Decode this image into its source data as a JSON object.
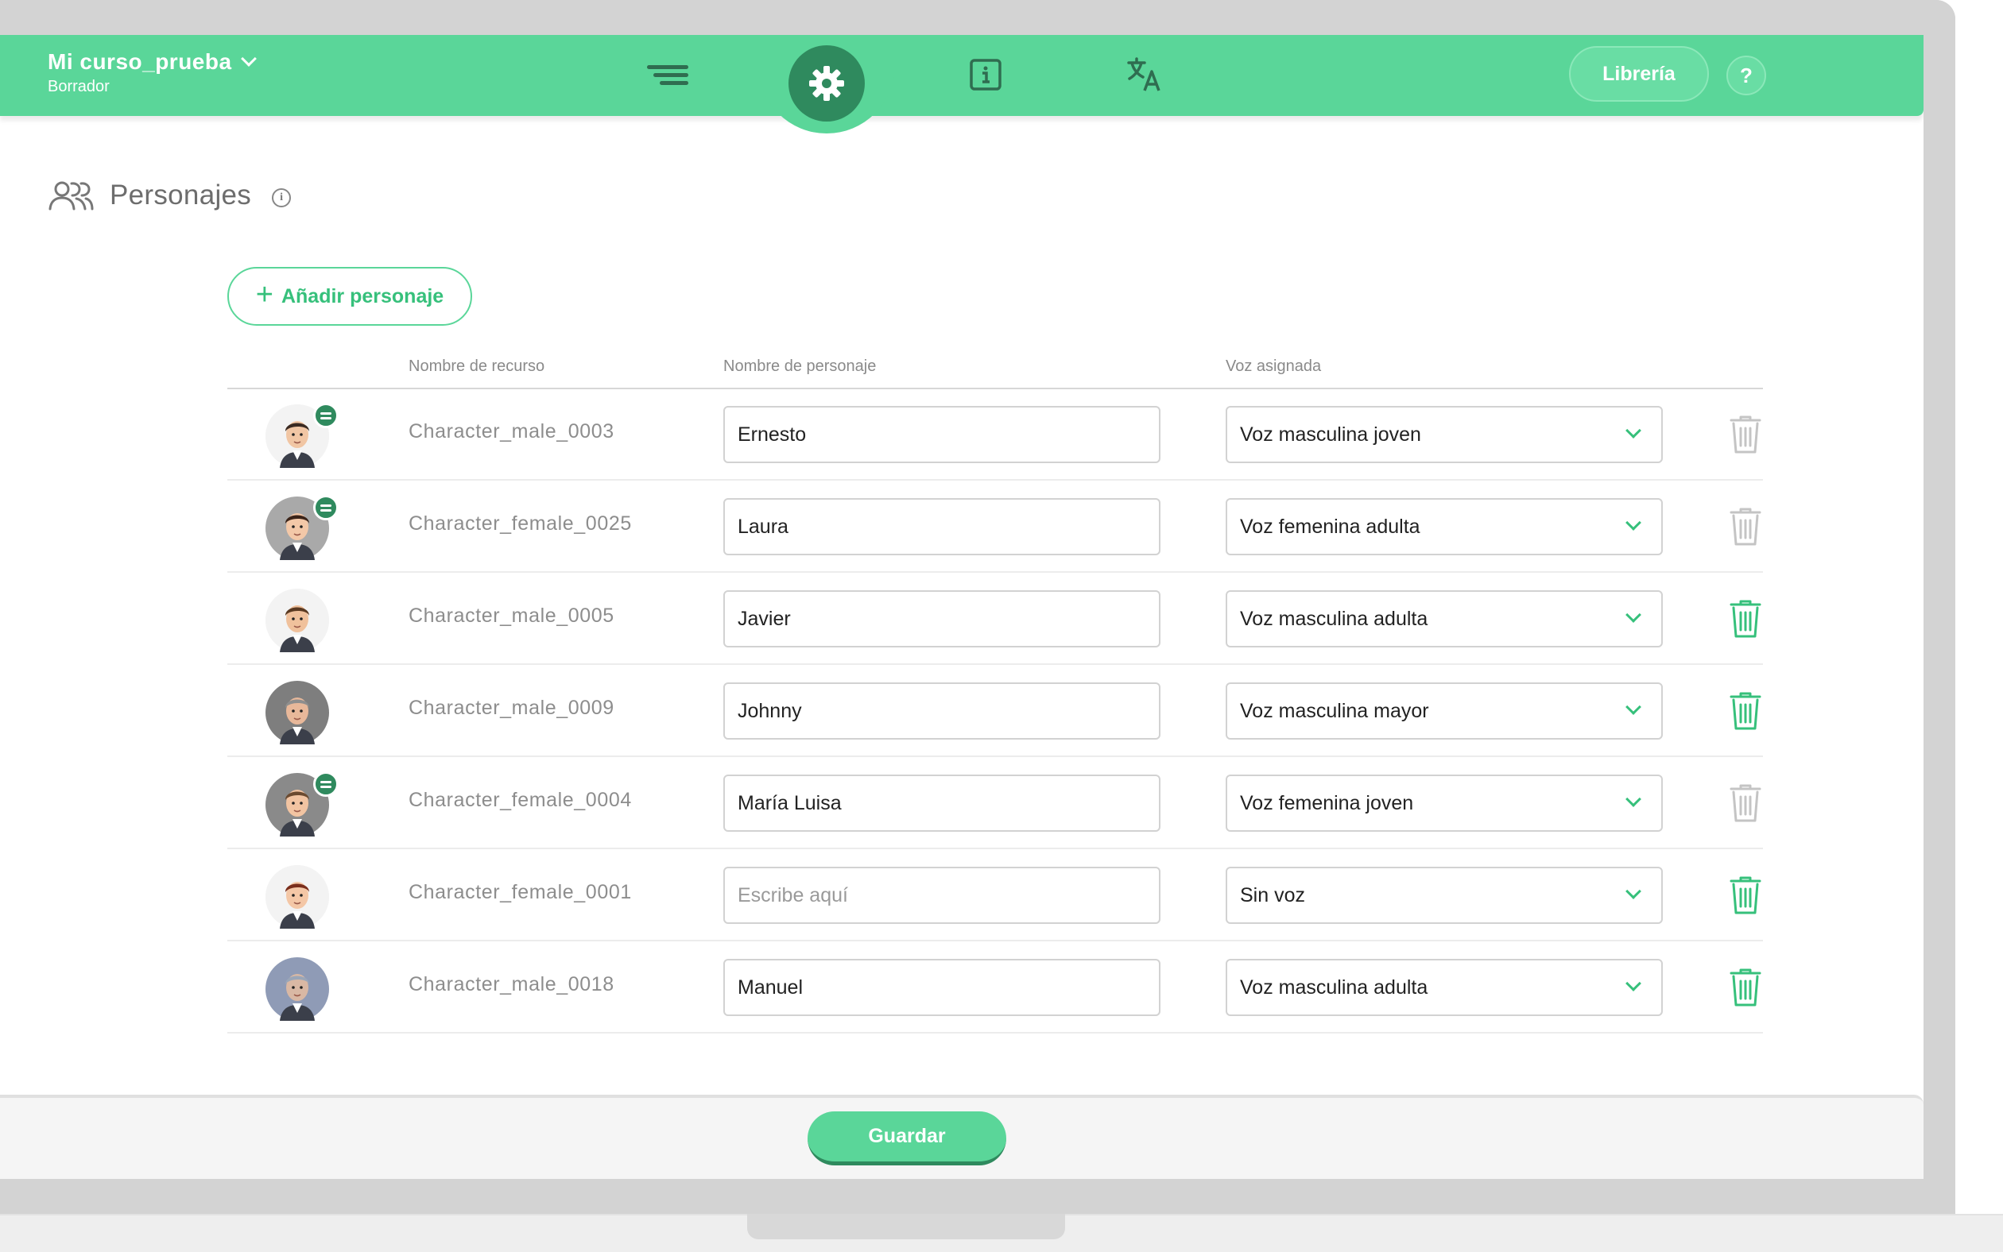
{
  "course": {
    "title": "Mi curso_prueba",
    "status": "Borrador"
  },
  "topbar": {
    "library_label": "Librería",
    "help_label": "?"
  },
  "section": {
    "title": "Personajes"
  },
  "actions": {
    "add_label": "Añadir personaje",
    "save_label": "Guardar"
  },
  "table": {
    "headers": {
      "resource": "Nombre de recurso",
      "character": "Nombre de personaje",
      "voice": "Voz asignada"
    },
    "placeholder": "Escribe aquí",
    "rows": [
      {
        "resource": "Character_male_0003",
        "name": "Ernesto",
        "voice": "Voz masculina joven",
        "has_dialog": true,
        "deletable": false,
        "avatar": "male-beard-avatar"
      },
      {
        "resource": "Character_female_0025",
        "name": "Laura",
        "voice": "Voz femenina adulta",
        "has_dialog": true,
        "deletable": false,
        "avatar": "female-dark-hair-avatar"
      },
      {
        "resource": "Character_male_0005",
        "name": "Javier",
        "voice": "Voz masculina adulta",
        "has_dialog": false,
        "deletable": true,
        "avatar": "male-young-avatar"
      },
      {
        "resource": "Character_male_0009",
        "name": "Johnny",
        "voice": "Voz masculina mayor",
        "has_dialog": false,
        "deletable": true,
        "avatar": "male-elder-avatar"
      },
      {
        "resource": "Character_female_0004",
        "name": "María Luisa",
        "voice": "Voz femenina joven",
        "has_dialog": true,
        "deletable": false,
        "avatar": "female-ponytail-avatar"
      },
      {
        "resource": "Character_female_0001",
        "name": "",
        "voice": "Sin voz",
        "has_dialog": false,
        "deletable": true,
        "avatar": "female-redhead-avatar"
      },
      {
        "resource": "Character_male_0018",
        "name": "Manuel",
        "voice": "Voz masculina adulta",
        "has_dialog": false,
        "deletable": true,
        "avatar": "male-bald-avatar"
      }
    ]
  },
  "colors": {
    "accent": "#5ad699",
    "accent_dark": "#2f8a5e",
    "trash_active": "#36c07b",
    "trash_disabled": "#c4c4c4"
  }
}
